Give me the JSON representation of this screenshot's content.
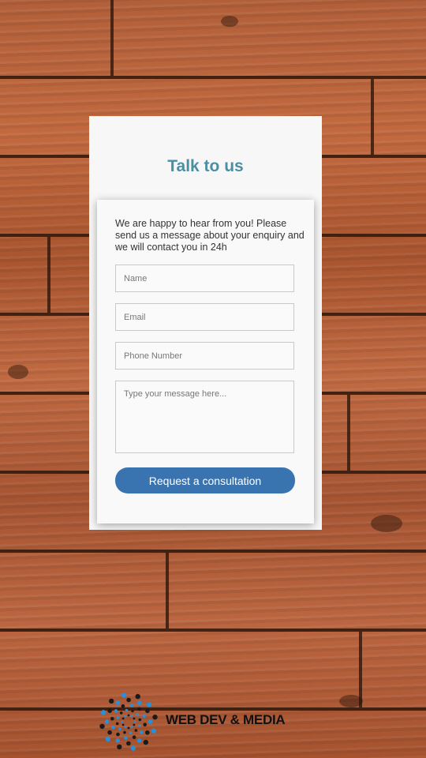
{
  "page": {
    "title": "Talk to us",
    "intro": "We are happy to hear from you! Please send us a message about your enquiry and we will contact you in 24h"
  },
  "form": {
    "name_placeholder": "Name",
    "email_placeholder": "Email",
    "phone_placeholder": "Phone Number",
    "message_placeholder": "Type your message here...",
    "submit_label": "Request a consultation"
  },
  "brand": {
    "name": "WEB DEV & MEDIA",
    "logo_icon": "spiral-dots-icon"
  },
  "colors": {
    "title": "#4a8fa3",
    "button": "#3a74b0",
    "logo_primary": "#2a8fd6",
    "logo_secondary": "#1a1a1a"
  }
}
